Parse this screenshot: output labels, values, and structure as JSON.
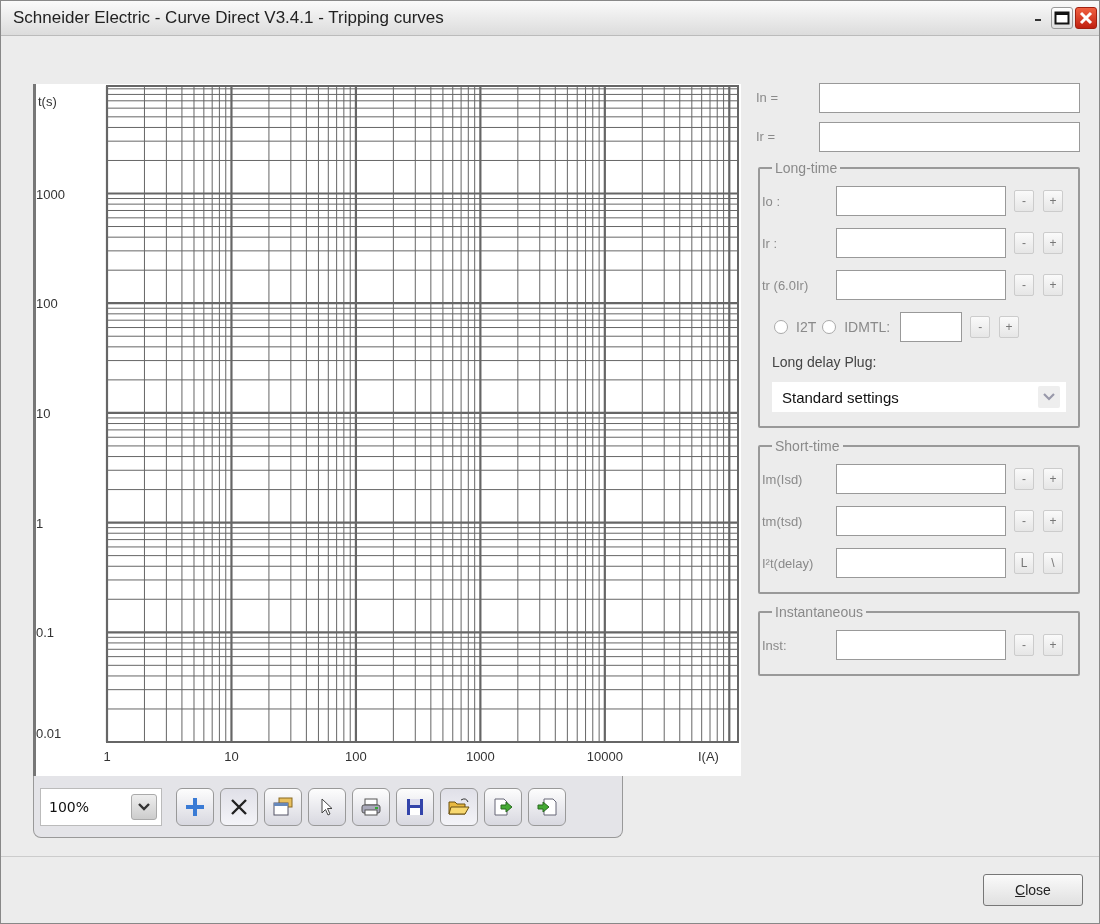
{
  "window": {
    "title": "Schneider Electric - Curve Direct V3.4.1 - Tripping curves"
  },
  "chart": {
    "x_axis_title": "I(A)",
    "y_axis_title": "t(s)",
    "x_labels": [
      "1",
      "10",
      "100",
      "1000",
      "10000"
    ],
    "y_labels": [
      "1000",
      "100",
      "10",
      "1",
      "0.1",
      "0.01"
    ]
  },
  "toolbar": {
    "zoom": "100%"
  },
  "settings": {
    "top_fields": [
      {
        "label": "In ="
      },
      {
        "label": "Ir ="
      }
    ],
    "groups": [
      {
        "title": "Long-time",
        "rows": [
          {
            "kind": "field",
            "label": "Io :",
            "buttons": [
              "-",
              "+"
            ]
          },
          {
            "kind": "field",
            "label": "Ir :",
            "buttons": [
              "-",
              "+"
            ]
          },
          {
            "kind": "field",
            "label": "tr (6.0Ir)",
            "buttons": [
              "-",
              "+"
            ]
          },
          {
            "kind": "radio",
            "options": [
              {
                "label": "I2T",
                "selected": false
              },
              {
                "label": "IDMTL:",
                "selected": false
              }
            ],
            "buttons": [
              "-",
              "+"
            ]
          },
          {
            "kind": "caption",
            "label": "Long delay Plug:"
          },
          {
            "kind": "select",
            "value": "Standard settings"
          }
        ]
      },
      {
        "title": "Short-time",
        "rows": [
          {
            "kind": "field",
            "label": "Im(Isd)",
            "buttons": [
              "-",
              "+"
            ]
          },
          {
            "kind": "field",
            "label": "tm(tsd)",
            "buttons": [
              "-",
              "+"
            ]
          },
          {
            "kind": "field",
            "label": "I²t(delay)",
            "buttons": [
              "L",
              "\\"
            ]
          }
        ]
      },
      {
        "title": "Instantaneous",
        "rows": [
          {
            "kind": "field",
            "label": "Inst:",
            "buttons": [
              "-",
              "+"
            ]
          }
        ]
      }
    ]
  },
  "close_button": "Close"
}
